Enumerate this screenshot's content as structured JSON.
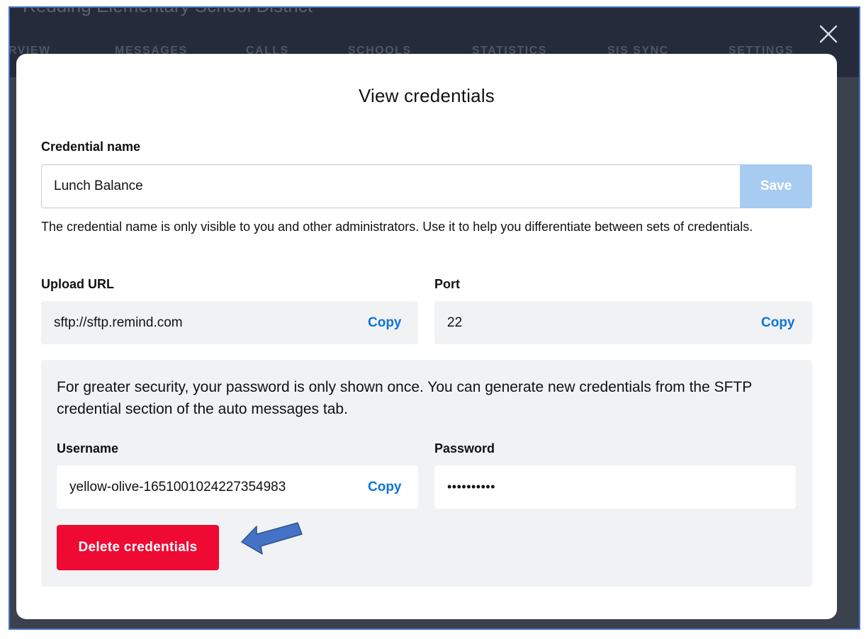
{
  "background": {
    "title": "Redding Elementary School District",
    "tabs": [
      "RVIEW",
      "MESSAGES",
      "CALLS",
      "SCHOOLS",
      "STATISTICS",
      "SIS SYNC",
      "SETTINGS"
    ]
  },
  "modal": {
    "title": "View credentials",
    "credential_name": {
      "label": "Credential name",
      "value": "Lunch Balance",
      "save_label": "Save",
      "help_text": "The credential name is only visible to you and other administrators. Use it to help you differentiate between sets of credentials."
    },
    "upload_url": {
      "label": "Upload URL",
      "value": "sftp://sftp.remind.com",
      "copy_label": "Copy"
    },
    "port": {
      "label": "Port",
      "value": "22",
      "copy_label": "Copy"
    },
    "security": {
      "notice": "For greater security, your password is only shown once. You can generate new credentials from the SFTP credential section of the auto messages tab.",
      "username": {
        "label": "Username",
        "value": "yellow-olive-1651001024227354983",
        "copy_label": "Copy"
      },
      "password": {
        "label": "Password",
        "value": "••••••••••"
      },
      "delete_label": "Delete credentials"
    }
  },
  "colors": {
    "accent_blue": "#0e74d6",
    "save_disabled": "#a8cbf1",
    "delete_red": "#ee0a33",
    "annotation_arrow": "#4472c4"
  },
  "icons": [
    "close-icon",
    "annotation-arrow"
  ]
}
